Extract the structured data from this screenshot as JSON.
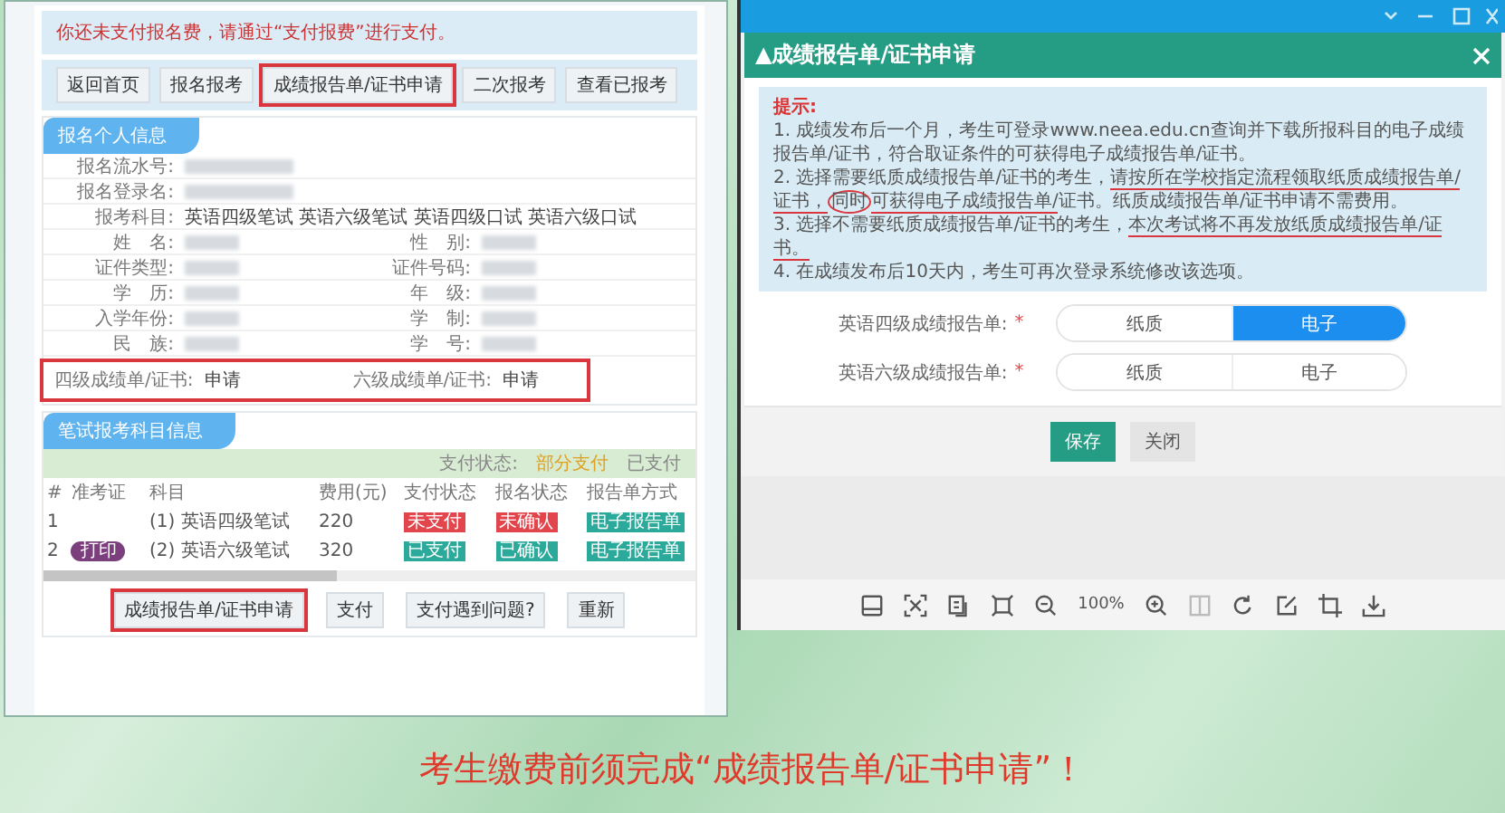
{
  "left_page": {
    "notice": "你还未支付报名费，请通过“支付报费”进行支付。",
    "nav_buttons": [
      {
        "label": "返回首页",
        "highlighted": false
      },
      {
        "label": "报名报考",
        "highlighted": false
      },
      {
        "label": "成绩报告单/证书申请",
        "highlighted": true
      },
      {
        "label": "二次报考",
        "highlighted": false
      },
      {
        "label": "查看已报考",
        "highlighted": false
      }
    ],
    "info_section": {
      "title": "报名个人信息",
      "top_rows": [
        {
          "label": "报名流水号:",
          "redacted": true
        },
        {
          "label": "报名登录名:",
          "redacted": true
        },
        {
          "label": "报考科目:",
          "value": "英语四级笔试  英语六级笔试  英语四级口试  英语六级口试"
        }
      ],
      "pairs": [
        {
          "left": "姓　名:",
          "right": "性　别:"
        },
        {
          "left": "证件类型:",
          "right": "证件号码:"
        },
        {
          "left": "学　历:",
          "right": "年　级:"
        },
        {
          "left": "入学年份:",
          "right": "学　制:"
        },
        {
          "left": "民　族:",
          "right": "学　号:"
        }
      ],
      "certificates": {
        "highlighted": true,
        "items": [
          {
            "label": "四级成绩单/证书:",
            "value": "申请"
          },
          {
            "label": "六级成绩单/证书:",
            "value": "申请"
          }
        ]
      }
    },
    "subjects_section": {
      "title": "笔试报考科目信息",
      "status_bar": [
        {
          "text": "支付状态:",
          "kind": "label"
        },
        {
          "text": "部分支付",
          "kind": "warn"
        },
        {
          "text": "已支付",
          "kind": "label"
        }
      ],
      "columns": [
        "#",
        "准考证",
        "科目",
        "费用(元)",
        "支付状态",
        "报名状态",
        "报告单方式"
      ],
      "rows": [
        {
          "cells": [
            "1",
            "",
            "(1) 英语四级笔试",
            "220",
            "未支付",
            "未确认",
            "电子报告单"
          ],
          "badge": null,
          "pay_ok": false,
          "reg_ok": false
        },
        {
          "cells": [
            "2",
            "",
            "(2) 英语六级笔试",
            "320",
            "已支付",
            "已确认",
            "电子报告单"
          ],
          "badge": "打印",
          "pay_ok": true,
          "reg_ok": true
        }
      ]
    },
    "bottom_buttons": [
      {
        "label": "成绩报告单/证书申请",
        "highlighted": true
      },
      {
        "label": "支付",
        "highlighted": false
      },
      {
        "label": "支付遇到问题?",
        "highlighted": false
      },
      {
        "label": "重新",
        "highlighted": false
      }
    ]
  },
  "dialog": {
    "title": "▲成绩报告单/证书申请",
    "hint_title": "提示:",
    "hints": [
      [
        {
          "text": "1. 成绩发布后一个月，考生可登录www.neea.edu.cn查询并下载所报科目的电子成绩报告单/证书，符合取证条件的可获得电子成绩报告单/证书。",
          "underlined": false,
          "circled": false
        }
      ],
      [
        {
          "text": "2. 选择需要纸质成绩报告单/证书的考生，",
          "underlined": false,
          "circled": false
        },
        {
          "text": "请按所在学校指定流程领取纸质成绩报告单/证书，",
          "underlined": true,
          "circled": false
        },
        {
          "text": "同时",
          "underlined": false,
          "circled": true
        },
        {
          "text": "可获得电子成绩报告单/",
          "underlined": true,
          "circled": false
        },
        {
          "text": "证书。纸质成绩报告单/证书申请不需费用。",
          "underlined": false,
          "circled": false
        }
      ],
      [
        {
          "text": "3. 选择不需要纸质成绩报告单/证书的考生，",
          "underlined": false,
          "circled": false
        },
        {
          "text": "本次考试将不再发放纸质成绩报告单/证书。",
          "underlined": true,
          "circled": false
        }
      ],
      [
        {
          "text": "4. 在成绩发布后10天内，考生可再次登录系统修改该选项。",
          "underlined": false,
          "circled": false
        }
      ]
    ],
    "options": [
      {
        "label": "英语四级成绩报告单:",
        "required_mark": "*",
        "choices": [
          {
            "label": "纸质",
            "selected": false
          },
          {
            "label": "电子",
            "selected": true
          }
        ]
      },
      {
        "label": "英语六级成绩报告单:",
        "required_mark": "*",
        "choices": [
          {
            "label": "纸质",
            "selected": false
          },
          {
            "label": "电子",
            "selected": false
          }
        ]
      }
    ],
    "buttons": [
      {
        "label": "保存",
        "kind": "primary"
      },
      {
        "label": "关闭",
        "kind": "plain"
      }
    ]
  },
  "viewer_toolbar": {
    "zoom": "100%"
  },
  "caption": "考生缴费前须完成“成绩报告单/证书申请”！"
}
